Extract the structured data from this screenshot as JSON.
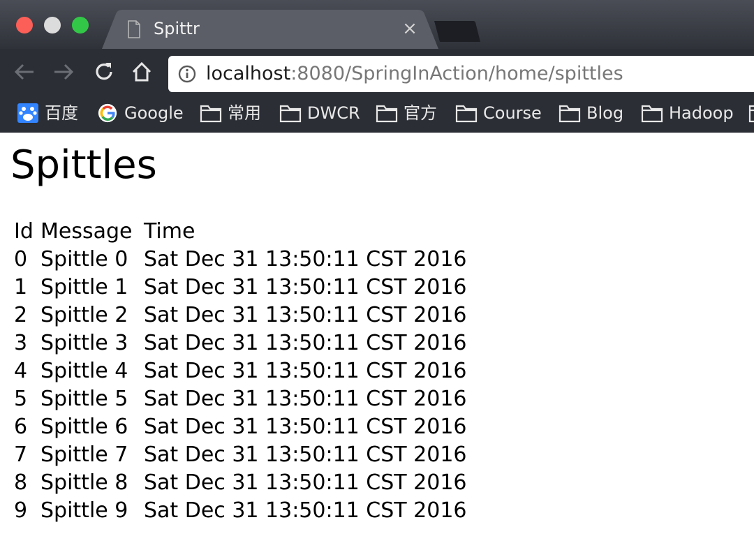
{
  "window": {
    "tab_title": "Spittr",
    "tab_close_glyph": "×"
  },
  "address_bar": {
    "host": "localhost",
    "rest": ":8080/SpringInAction/home/spittles"
  },
  "bookmarks": [
    {
      "label": "百度",
      "icon": "baidu-icon"
    },
    {
      "label": "Google",
      "icon": "google-icon"
    },
    {
      "label": "常用",
      "icon": "folder-icon"
    },
    {
      "label": "DWCR",
      "icon": "folder-icon"
    },
    {
      "label": "官方",
      "icon": "folder-icon"
    },
    {
      "label": "Course",
      "icon": "folder-icon"
    },
    {
      "label": "Blog",
      "icon": "folder-icon"
    },
    {
      "label": "Hadoop",
      "icon": "folder-icon"
    }
  ],
  "page": {
    "title": "Spittles",
    "table": {
      "headers": [
        "Id",
        "Message",
        "Time"
      ],
      "rows": [
        [
          "0",
          "Spittle 0",
          "Sat Dec 31 13:50:11 CST 2016"
        ],
        [
          "1",
          "Spittle 1",
          "Sat Dec 31 13:50:11 CST 2016"
        ],
        [
          "2",
          "Spittle 2",
          "Sat Dec 31 13:50:11 CST 2016"
        ],
        [
          "3",
          "Spittle 3",
          "Sat Dec 31 13:50:11 CST 2016"
        ],
        [
          "4",
          "Spittle 4",
          "Sat Dec 31 13:50:11 CST 2016"
        ],
        [
          "5",
          "Spittle 5",
          "Sat Dec 31 13:50:11 CST 2016"
        ],
        [
          "6",
          "Spittle 6",
          "Sat Dec 31 13:50:11 CST 2016"
        ],
        [
          "7",
          "Spittle 7",
          "Sat Dec 31 13:50:11 CST 2016"
        ],
        [
          "8",
          "Spittle 8",
          "Sat Dec 31 13:50:11 CST 2016"
        ],
        [
          "9",
          "Spittle 9",
          "Sat Dec 31 13:50:11 CST 2016"
        ]
      ]
    }
  },
  "colors": {
    "traffic_close": "#fc5f57",
    "traffic_min": "#dcdcdc",
    "traffic_max": "#33c748",
    "chrome_dark": "#2b2e35"
  }
}
